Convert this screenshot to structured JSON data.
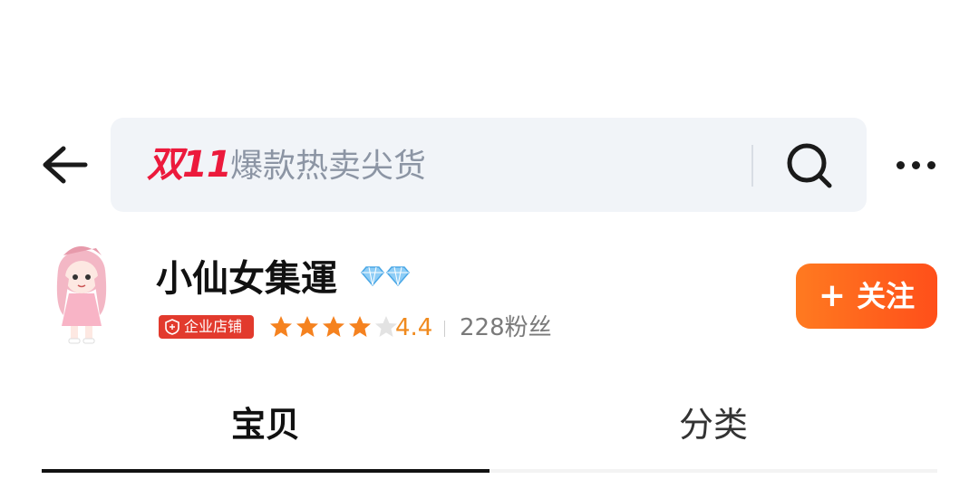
{
  "header": {
    "search_tag": "双11",
    "search_placeholder": "爆款热卖尖货"
  },
  "shop": {
    "name": "小仙女集運",
    "badge_label": "企业店铺",
    "rating": "4.4",
    "rating_value": 4.4,
    "rating_max": 5,
    "followers": "228粉丝",
    "follow_button": "关注"
  },
  "tabs": [
    {
      "label": "宝贝",
      "active": true
    },
    {
      "label": "分类",
      "active": false
    }
  ],
  "colors": {
    "accent_orange": "#ff5a1f",
    "tag_red": "#ec1a3c",
    "star": "#f5821f",
    "badge_red": "#e23a2d"
  },
  "icons": [
    "back-arrow-icon",
    "search-icon",
    "more-dots-icon",
    "diamond-icon",
    "enterprise-badge-icon",
    "star-icon",
    "plus-icon"
  ]
}
